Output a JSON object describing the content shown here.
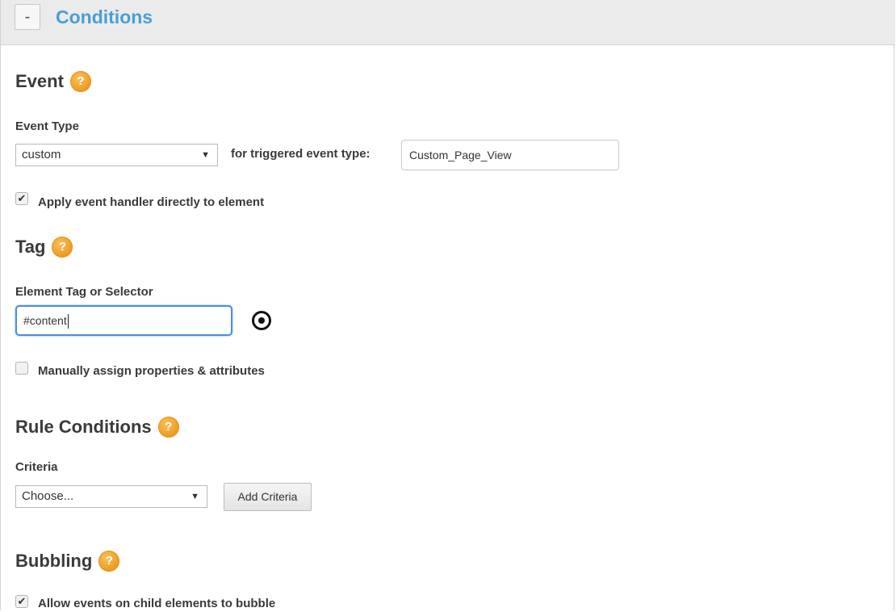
{
  "colors": {
    "accent": "#4a9fd4",
    "help": "#f0a22c",
    "header_bg": "#ebebeb"
  },
  "header": {
    "collapse_symbol": "-",
    "title": "Conditions"
  },
  "event": {
    "heading": "Event",
    "help_icon": "help-icon",
    "type_label": "Event Type",
    "type_value": "custom",
    "triggered_label": "for triggered event type:",
    "triggered_value": "Custom_Page_View",
    "apply_handler_label": "Apply event handler directly to element",
    "apply_handler_checked": true
  },
  "tag": {
    "heading": "Tag",
    "selector_label": "Element Tag or Selector",
    "selector_value": "#content",
    "target_icon": "target-icon",
    "manual_assign_label": "Manually assign properties & attributes",
    "manual_assign_checked": false
  },
  "rule_conditions": {
    "heading": "Rule Conditions",
    "criteria_label": "Criteria",
    "criteria_value": "Choose...",
    "add_button": "Add Criteria"
  },
  "bubbling": {
    "heading": "Bubbling",
    "allow_label": "Allow events on child elements to bubble",
    "allow_checked": true
  },
  "glyphs": {
    "check": "✔",
    "dropdown": "▼",
    "help": "?"
  }
}
